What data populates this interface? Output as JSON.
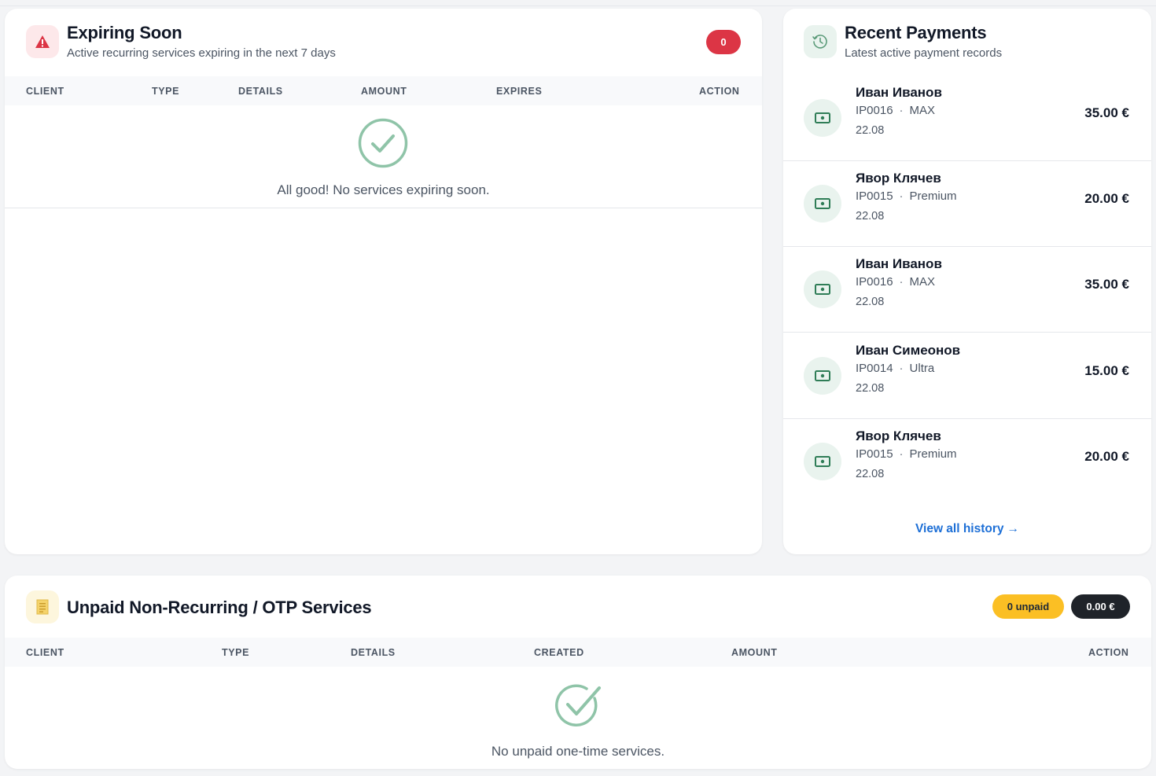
{
  "expiring": {
    "title": "Expiring Soon",
    "subtitle": "Active recurring services expiring in the next 7 days",
    "count": "0",
    "columns": [
      "CLIENT",
      "TYPE",
      "DETAILS",
      "AMOUNT",
      "EXPIRES",
      "ACTION"
    ],
    "empty_message": "All good! No services expiring soon.",
    "icon": "warning-triangle-icon",
    "accent_color": "#dc3545"
  },
  "payments": {
    "title": "Recent Payments",
    "subtitle": "Latest active payment records",
    "icon": "clock-history-icon",
    "items": [
      {
        "name": "Иван Иванов",
        "code": "IP0016",
        "plan": "MAX",
        "date": "22.08",
        "amount": "35.00 €"
      },
      {
        "name": "Явор Клячев",
        "code": "IP0015",
        "plan": "Premium",
        "date": "22.08",
        "amount": "20.00 €"
      },
      {
        "name": "Иван Иванов",
        "code": "IP0016",
        "plan": "MAX",
        "date": "22.08",
        "amount": "35.00 €"
      },
      {
        "name": "Иван Симеонов",
        "code": "IP0014",
        "plan": "Ultra",
        "date": "22.08",
        "amount": "15.00 €"
      },
      {
        "name": "Явор Клячев",
        "code": "IP0015",
        "plan": "Premium",
        "date": "22.08",
        "amount": "20.00 €"
      }
    ],
    "separator": "·",
    "view_all_label": "View all history",
    "view_all_arrow": "→",
    "link_color": "#1d6fd6"
  },
  "unpaid": {
    "title": "Unpaid Non-Recurring / OTP Services",
    "unpaid_badge": "0 unpaid",
    "total_badge": "0.00 €",
    "columns": [
      "CLIENT",
      "TYPE",
      "DETAILS",
      "CREATED",
      "AMOUNT",
      "ACTION"
    ],
    "empty_message": "No unpaid one-time services.",
    "icon": "receipt-icon",
    "badge_color": "#fbbf24"
  }
}
